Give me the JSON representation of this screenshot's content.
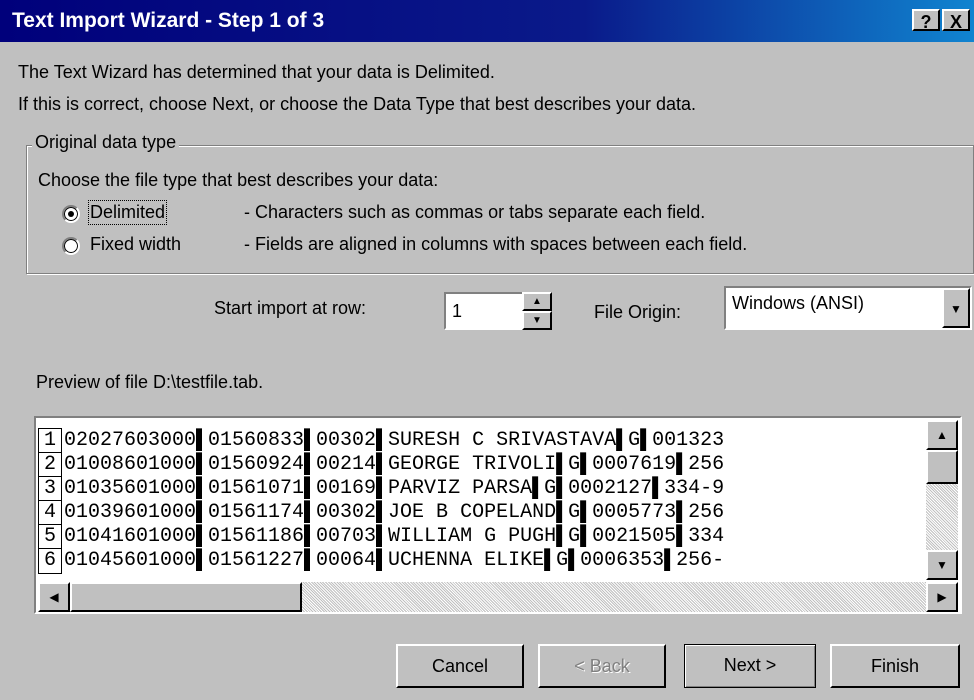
{
  "window": {
    "title": "Text Import Wizard - Step 1 of 3",
    "help_label": "?",
    "close_label": "X"
  },
  "intro": {
    "line1": "The Text Wizard has determined that your data is Delimited.",
    "line2": "If this is correct, choose Next, or choose the Data Type that best describes your data."
  },
  "original_data_type": {
    "legend": "Original data type",
    "prompt": "Choose the file type that best describes your data:",
    "options": [
      {
        "label": "Delimited",
        "description": "- Characters such as commas or tabs separate each field.",
        "selected": true
      },
      {
        "label": "Fixed width",
        "description": "- Fields are aligned in columns with spaces between each field.",
        "selected": false
      }
    ]
  },
  "start_import": {
    "label": "Start import at row:",
    "value": "1"
  },
  "file_origin": {
    "label": "File Origin:",
    "value": "Windows (ANSI)"
  },
  "preview": {
    "label": "Preview of file D:\\testfile.tab.",
    "rows": [
      {
        "num": "1",
        "text": "02027603000▌01560833▌00302▌SURESH C SRIVASTAVA▌G▌001323"
      },
      {
        "num": "2",
        "text": "01008601000▌01560924▌00214▌GEORGE TRIVOLI▌G▌0007619▌256"
      },
      {
        "num": "3",
        "text": "01035601000▌01561071▌00169▌PARVIZ PARSA▌G▌0002127▌334-9"
      },
      {
        "num": "4",
        "text": "01039601000▌01561174▌00302▌JOE B COPELAND▌G▌0005773▌256"
      },
      {
        "num": "5",
        "text": "01041601000▌01561186▌00703▌WILLIAM G PUGH▌G▌0021505▌334"
      },
      {
        "num": "6",
        "text": "01045601000▌01561227▌00064▌UCHENNA ELIKE▌G▌0006353▌256-"
      }
    ]
  },
  "buttons": {
    "cancel": "Cancel",
    "back": "< Back",
    "next": "Next >",
    "finish": "Finish"
  }
}
